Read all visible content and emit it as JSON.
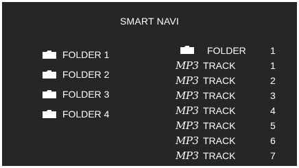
{
  "title": "SMART NAVI",
  "left_folders": [
    {
      "icon": "folder-icon",
      "label": "FOLDER 1"
    },
    {
      "icon": "folder-icon",
      "label": "FOLDER 2"
    },
    {
      "icon": "folder-icon",
      "label": "FOLDER 3"
    },
    {
      "icon": "folder-icon",
      "label": "FOLDER 4"
    }
  ],
  "right_items": [
    {
      "icon": "folder-icon",
      "label": "FOLDER",
      "number": "1"
    },
    {
      "icon": "mp3-icon",
      "icon_text": "MP3",
      "label": "TRACK",
      "number": "1"
    },
    {
      "icon": "mp3-icon",
      "icon_text": "MP3",
      "label": "TRACK",
      "number": "2"
    },
    {
      "icon": "mp3-icon",
      "icon_text": "MP3",
      "label": "TRACK",
      "number": "3"
    },
    {
      "icon": "mp3-icon",
      "icon_text": "MP3",
      "label": "TRACK",
      "number": "4"
    },
    {
      "icon": "mp3-icon",
      "icon_text": "MP3",
      "label": "TRACK",
      "number": "5"
    },
    {
      "icon": "mp3-icon",
      "icon_text": "MP3",
      "label": "TRACK",
      "number": "6"
    },
    {
      "icon": "mp3-icon",
      "icon_text": "MP3",
      "label": "TRACK",
      "number": "7"
    }
  ],
  "colors": {
    "background": "#262626",
    "text": "#ffffff",
    "frame": "#ffffff"
  }
}
